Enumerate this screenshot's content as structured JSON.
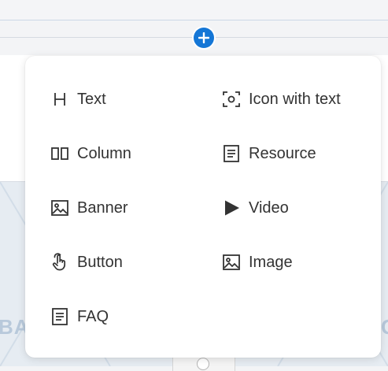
{
  "menu": {
    "items": [
      {
        "label": "Text",
        "icon": "heading-icon"
      },
      {
        "label": "Icon with text",
        "icon": "icon-frame-icon"
      },
      {
        "label": "Column",
        "icon": "columns-icon"
      },
      {
        "label": "Resource",
        "icon": "document-icon"
      },
      {
        "label": "Banner",
        "icon": "image-icon"
      },
      {
        "label": "Video",
        "icon": "play-icon"
      },
      {
        "label": "Button",
        "icon": "pointer-hand-icon"
      },
      {
        "label": "Image",
        "icon": "image-icon"
      },
      {
        "label": "FAQ",
        "icon": "document-icon"
      }
    ]
  },
  "background": {
    "banner_text_left": "BA",
    "banner_text_right": "G"
  },
  "colors": {
    "accent": "#1476d6",
    "icon": "#333333"
  }
}
